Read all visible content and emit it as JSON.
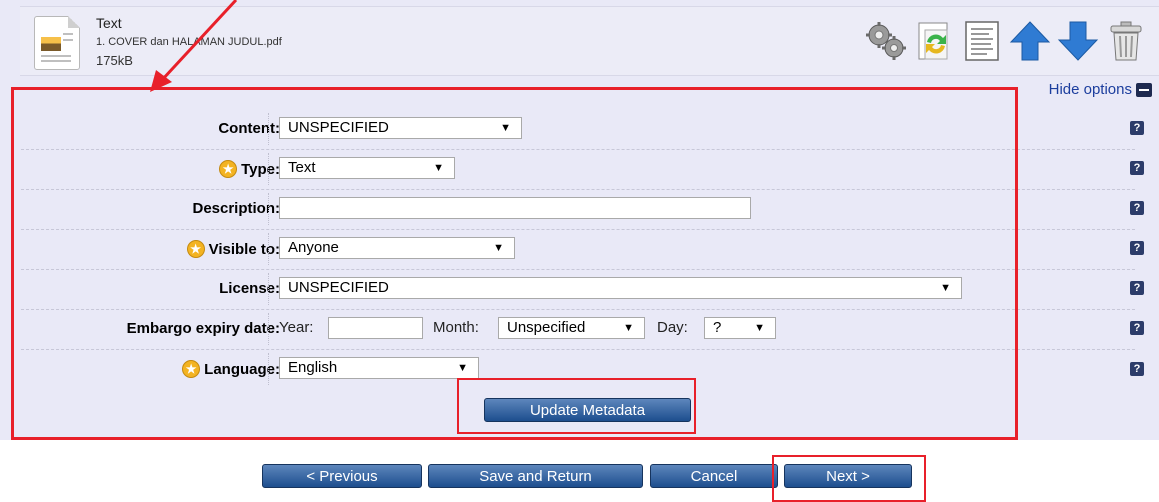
{
  "file": {
    "title": "Text",
    "name": "1. COVER dan HALAMAN JUDUL.pdf",
    "size": "175kB"
  },
  "hide_options": "Hide options",
  "form": {
    "content": {
      "label": "Content:",
      "value": "UNSPECIFIED"
    },
    "type": {
      "label": "Type:",
      "value": "Text"
    },
    "description": {
      "label": "Description:",
      "value": ""
    },
    "visible_to": {
      "label": "Visible to:",
      "value": "Anyone"
    },
    "license": {
      "label": "License:",
      "value": "UNSPECIFIED"
    },
    "embargo": {
      "label": "Embargo expiry date:",
      "year_label": "Year:",
      "year_value": "",
      "month_label": "Month:",
      "month_value": "Unspecified",
      "day_label": "Day:",
      "day_value": "?"
    },
    "language": {
      "label": "Language:",
      "value": "English"
    },
    "help": "?"
  },
  "buttons": {
    "update_metadata": "Update Metadata",
    "previous": "< Previous",
    "save_and_return": "Save and Return",
    "cancel": "Cancel",
    "next": "Next >"
  },
  "icons": [
    "gear-icon",
    "document-refresh-icon",
    "document-list-icon",
    "arrow-up-icon",
    "arrow-down-icon",
    "trash-icon"
  ],
  "colors": {
    "panel": "#e9e9f7",
    "button": "#1d4e8e",
    "annotation": "#e8202a",
    "help": "#2c3c6a",
    "link": "#1c3e9e"
  }
}
